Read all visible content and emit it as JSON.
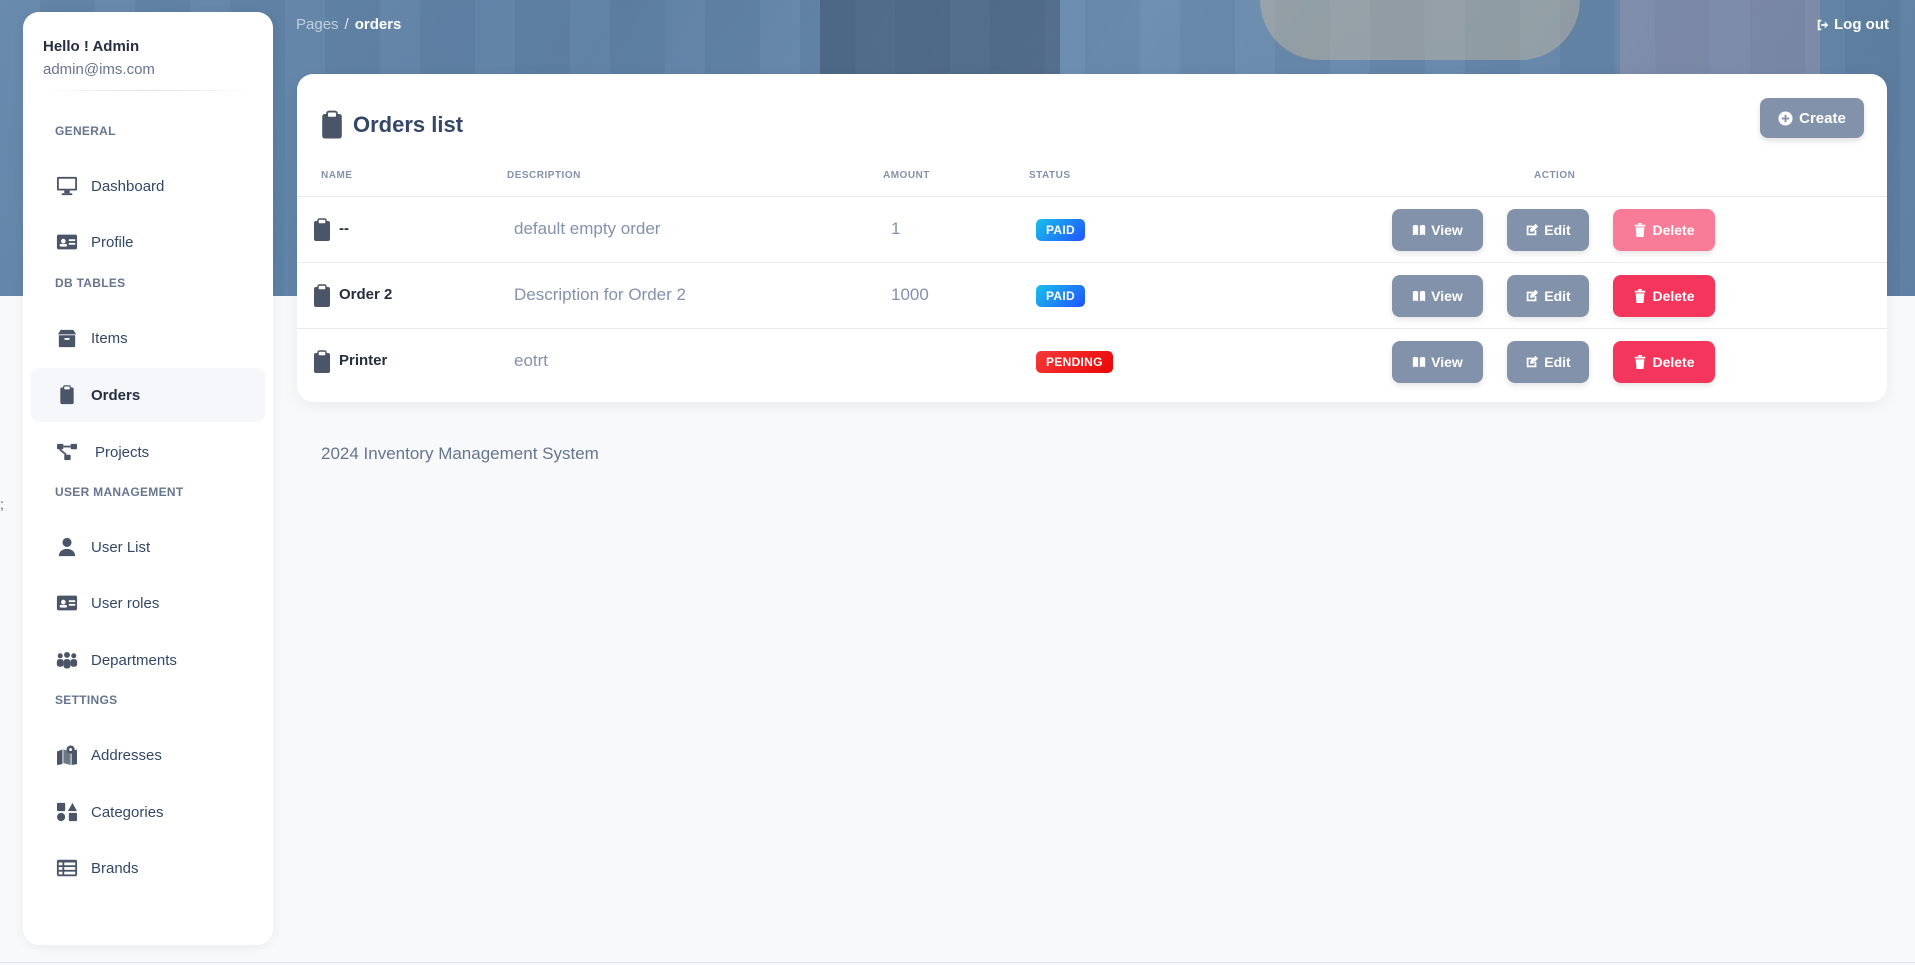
{
  "sidebar": {
    "hello": "Hello ! Admin",
    "email": "admin@ims.com",
    "sections": {
      "general": "GENERAL",
      "db_tables": "DB TABLES",
      "user_management": "USER MANAGEMENT",
      "settings": "SETTINGS"
    },
    "items": {
      "dashboard": "Dashboard",
      "profile": "Profile",
      "items": "Items",
      "orders": "Orders",
      "projects": "Projects",
      "user_list": "User List",
      "user_roles": "User roles",
      "departments": "Departments",
      "addresses": "Addresses",
      "categories": "Categories",
      "brands": "Brands"
    }
  },
  "header": {
    "breadcrumb_root": "Pages",
    "breadcrumb_sep": "/",
    "breadcrumb_current": "orders",
    "logout": "Log out"
  },
  "card": {
    "title": "Orders list",
    "create": "Create",
    "columns": {
      "name": "NAME",
      "description": "DESCRIPTION",
      "amount": "AMOUNT",
      "status": "STATUS",
      "action": "ACTION"
    },
    "rows": [
      {
        "name": "--",
        "description": "default empty order",
        "amount": "1",
        "status": "PAID"
      },
      {
        "name": "Order 2",
        "description": "Description for Order 2",
        "amount": "1000",
        "status": "PAID"
      },
      {
        "name": "Printer",
        "description": "eotrt",
        "amount": "",
        "status": "PENDING"
      }
    ],
    "buttons": {
      "view": "View",
      "edit": "Edit",
      "delete": "Delete"
    }
  },
  "footer": "2024 Inventory Management System",
  "colors": {
    "sidebar_bg": "#ffffff",
    "button_secondary": "#8392ab",
    "button_danger": "#f5365c",
    "badge_paid": "#17c1e8",
    "badge_pending": "#f53939"
  }
}
